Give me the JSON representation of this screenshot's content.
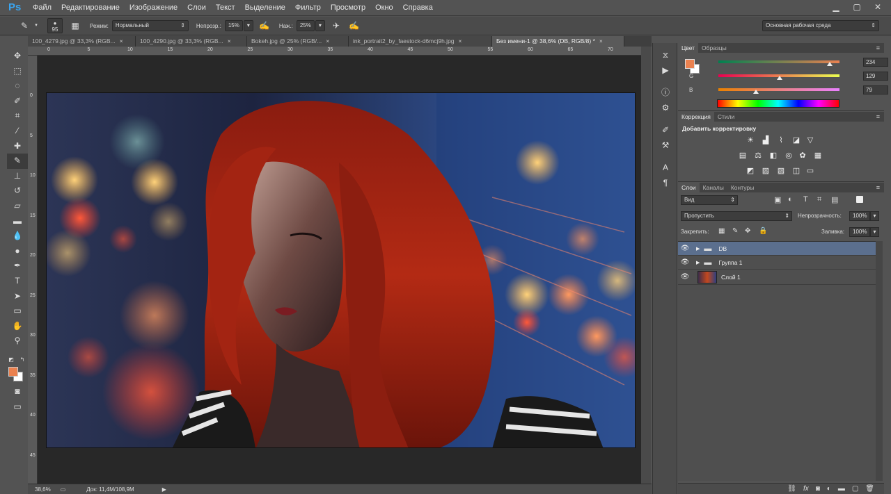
{
  "app": {
    "logo": "Ps"
  },
  "menu": [
    "Файл",
    "Редактирование",
    "Изображение",
    "Слои",
    "Текст",
    "Выделение",
    "Фильтр",
    "Просмотр",
    "Окно",
    "Справка"
  ],
  "window_buttons": [
    "▁",
    "▢",
    "✕"
  ],
  "options": {
    "brush_size": "95",
    "mode_label": "Режим:",
    "mode_value": "Нормальный",
    "opacity_label": "Непрозр.:",
    "opacity_value": "15%",
    "pressure_label": "Наж.:",
    "pressure_value": "25%",
    "workspace": "Основная рабочая среда"
  },
  "tabs": [
    {
      "label": "100_4279.jpg @ 33,3% (RGB...",
      "active": false
    },
    {
      "label": "100_4290.jpg @ 33,3% (RGB...",
      "active": false
    },
    {
      "label": "Bokeh.jpg @ 25% (RGB/...",
      "active": false
    },
    {
      "label": "ink_portrait2_by_faestock-d6mcj9h.jpg",
      "active": false
    },
    {
      "label": "Без имени-1 @ 38,6% (DB, RGB/8) *",
      "active": true
    }
  ],
  "tab_close": "×",
  "ruler": {
    "h_ticks": [
      "0",
      "5",
      "10",
      "15",
      "20",
      "25",
      "30",
      "35",
      "40",
      "45",
      "50",
      "55",
      "60",
      "65",
      "70"
    ],
    "v_ticks": [
      "0",
      "5",
      "10",
      "15",
      "20",
      "25",
      "30",
      "35",
      "40",
      "45"
    ]
  },
  "status": {
    "zoom": "38,6%",
    "doc": "Док: 11,4M/108,9M"
  },
  "color_panel": {
    "tabs": [
      "Цвет",
      "Образцы"
    ],
    "foreground": "#ea814f",
    "background": "#ffffff",
    "channels": [
      {
        "label": "R",
        "value": "234",
        "level": 0.918
      },
      {
        "label": "G",
        "value": "129",
        "level": 0.506
      },
      {
        "label": "B",
        "value": "79",
        "level": 0.31
      }
    ]
  },
  "adjust_panel": {
    "tabs": [
      "Коррекция",
      "Стили"
    ],
    "title": "Добавить корректировку",
    "icons": [
      "brightness-icon",
      "levels-icon",
      "curves-icon",
      "exposure-icon",
      "vibrance-icon",
      "hue-saturation-icon",
      "color-balance-icon",
      "black-white-icon",
      "photo-filter-icon",
      "channel-mixer-icon",
      "color-lookup-icon",
      "invert-icon",
      "posterize-icon",
      "threshold-icon",
      "selective-color-icon",
      "gradient-map-icon"
    ]
  },
  "layers_panel": {
    "tabs": [
      "Слои",
      "Каналы",
      "Контуры"
    ],
    "filter": "Вид",
    "blend": "Пропустить",
    "opacity_label": "Непрозрачность:",
    "opacity_value": "100%",
    "lock_label": "Закрепить:",
    "fill_label": "Заливка:",
    "fill_value": "100%",
    "layers": [
      {
        "name": "DB",
        "type": "group",
        "selected": true
      },
      {
        "name": "Группа 1",
        "type": "group",
        "selected": false
      },
      {
        "name": "Слой 1",
        "type": "image",
        "selected": false
      }
    ]
  },
  "colors": {
    "accent": "#3aa5f0",
    "selected_layer": "#5b6f8e"
  }
}
